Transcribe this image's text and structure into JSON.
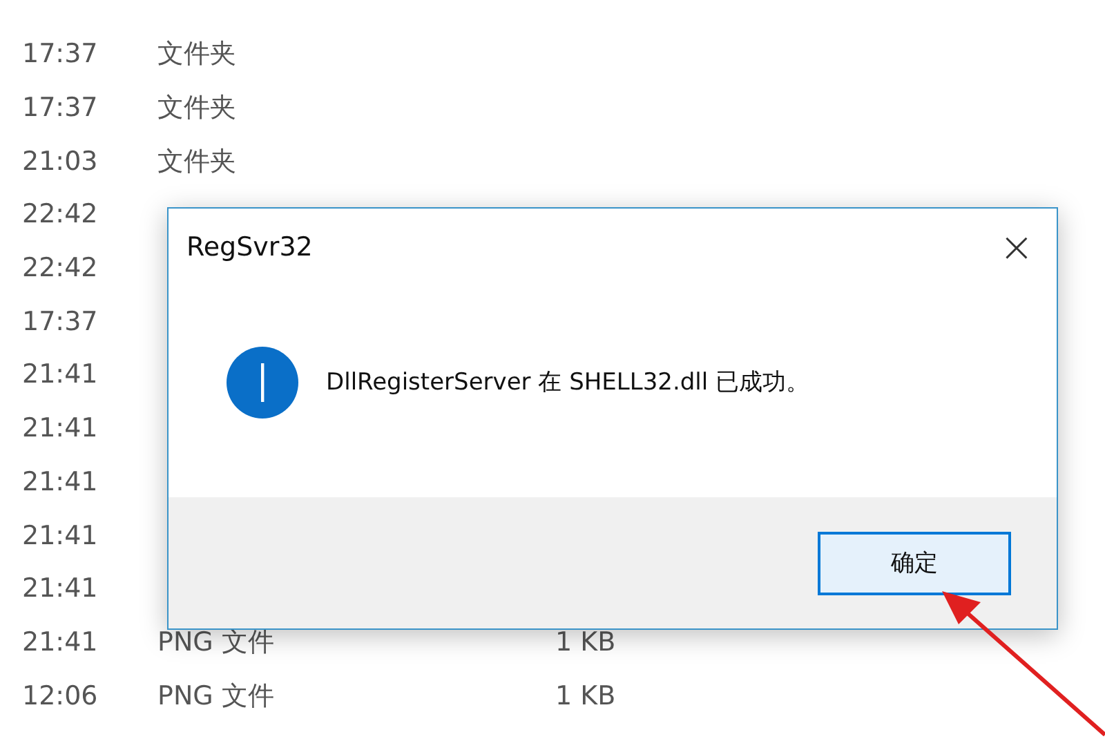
{
  "file_list": {
    "rows": [
      {
        "modified": "17:37",
        "type": "文件夹"
      },
      {
        "modified": "17:37",
        "type": "文件夹"
      },
      {
        "modified": "21:03",
        "type": "文件夹"
      },
      {
        "modified": "22:42"
      },
      {
        "modified": "22:42"
      },
      {
        "modified": "17:37"
      },
      {
        "modified": "21:41"
      },
      {
        "modified": "21:41"
      },
      {
        "modified": "21:41"
      },
      {
        "modified": "21:41"
      },
      {
        "modified": "21:41"
      },
      {
        "modified": "21:41",
        "type": "PNG 文件",
        "size": "1 KB"
      },
      {
        "modified": "12:06",
        "type": "PNG 文件",
        "size": "1 KB"
      }
    ]
  },
  "dialog": {
    "title": "RegSvr32",
    "close": "×",
    "message": "DllRegisterServer 在 SHELL32.dll 已成功。",
    "buttons": [
      {
        "label": "确定",
        "selected": true
      }
    ]
  },
  "annotation": {
    "kind": "arrow"
  }
}
